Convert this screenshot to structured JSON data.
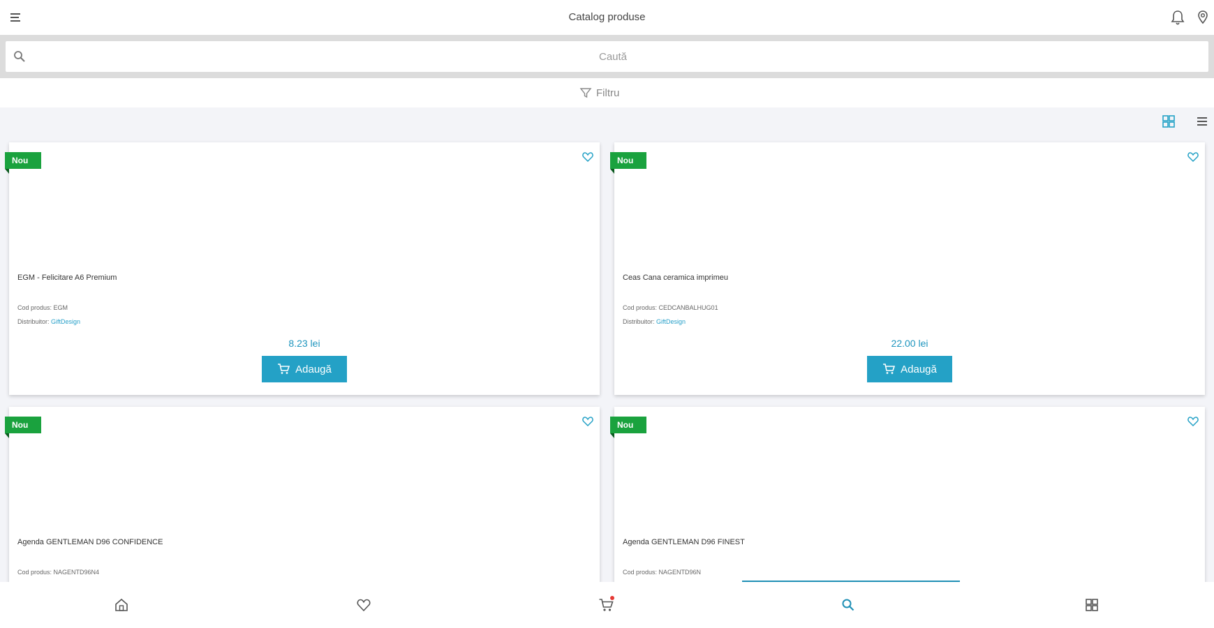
{
  "header": {
    "title": "Catalog produse"
  },
  "search": {
    "placeholder": "Caută"
  },
  "filter": {
    "label": "Filtru"
  },
  "colors": {
    "accent": "#24a1c6",
    "badge": "#1aa23e",
    "price": "#1e95be"
  },
  "products": [
    {
      "badge": "Nou",
      "name": "EGM - Felicitare A6 Premium",
      "code_label": "Cod produs:",
      "code": "EGM",
      "dist_label": "Distribuitor:",
      "distributor": "GiftDesign",
      "price": "8.23 lei",
      "add_label": "Adaugă"
    },
    {
      "badge": "Nou",
      "name": "Ceas Cana ceramica imprimeu",
      "code_label": "Cod produs:",
      "code": "CEDCANBALHUG01",
      "dist_label": "Distribuitor:",
      "distributor": "GiftDesign",
      "price": "22.00 lei",
      "add_label": "Adaugă"
    },
    {
      "badge": "Nou",
      "name": "Agenda GENTLEMAN D96 CONFIDENCE",
      "code_label": "Cod produs:",
      "code": "NAGENTD96N4"
    },
    {
      "badge": "Nou",
      "name": "Agenda GENTLEMAN D96 FINEST",
      "code_label": "Cod produs:",
      "code": "NAGENTD96N"
    }
  ],
  "icons": {
    "menu": "menu-icon",
    "bell": "bell-icon",
    "location": "location-pin-icon",
    "search": "search-icon",
    "filter": "filter-icon",
    "grid": "grid-view-icon",
    "list": "list-view-icon",
    "heart": "heart-icon",
    "cart": "cart-icon",
    "home": "home-icon",
    "categories": "categories-icon"
  }
}
